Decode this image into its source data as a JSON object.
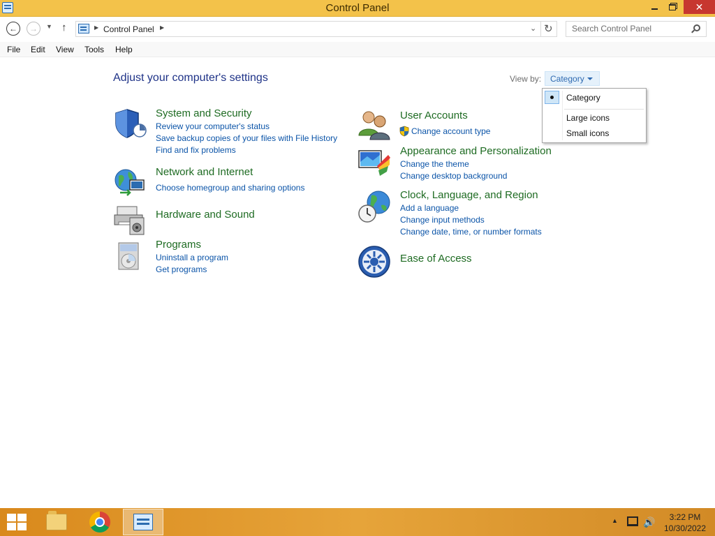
{
  "window": {
    "title": "Control Panel"
  },
  "address": {
    "crumb": "Control Panel",
    "search_placeholder": "Search Control Panel"
  },
  "menu": [
    "File",
    "Edit",
    "View",
    "Tools",
    "Help"
  ],
  "content": {
    "heading": "Adjust your computer's settings",
    "view_by_label": "View by:",
    "view_by_value": "Category"
  },
  "categories": {
    "system_security": {
      "title": "System and Security",
      "links": [
        "Review your computer's status",
        "Save backup copies of your files with File History",
        "Find and fix problems"
      ]
    },
    "network_internet": {
      "title": "Network and Internet",
      "links": [
        "Choose homegroup and sharing options"
      ]
    },
    "hardware_sound": {
      "title": "Hardware and Sound"
    },
    "programs": {
      "title": "Programs",
      "links": [
        "Uninstall a program",
        "Get programs"
      ]
    },
    "user_accounts": {
      "title": "User Accounts",
      "links": [
        "Change account type"
      ]
    },
    "appearance": {
      "title": "Appearance and Personalization",
      "links": [
        "Change the theme",
        "Change desktop background"
      ]
    },
    "clock_region": {
      "title": "Clock, Language, and Region",
      "links": [
        "Add a language",
        "Change input methods",
        "Change date, time, or number formats"
      ]
    },
    "ease_access": {
      "title": "Ease of Access"
    }
  },
  "view_dropdown": {
    "options": [
      "Category",
      "Large icons",
      "Small icons"
    ],
    "selected": "Category"
  },
  "taskbar": {
    "time": "3:22 PM",
    "date": "10/30/2022"
  },
  "colors": {
    "title_bar": "#f3c24a",
    "close_button": "#c7372f",
    "category_title": "#1e6b22",
    "link": "#0b54a8",
    "heading": "#1e3287",
    "taskbar": "#e6a43a"
  }
}
